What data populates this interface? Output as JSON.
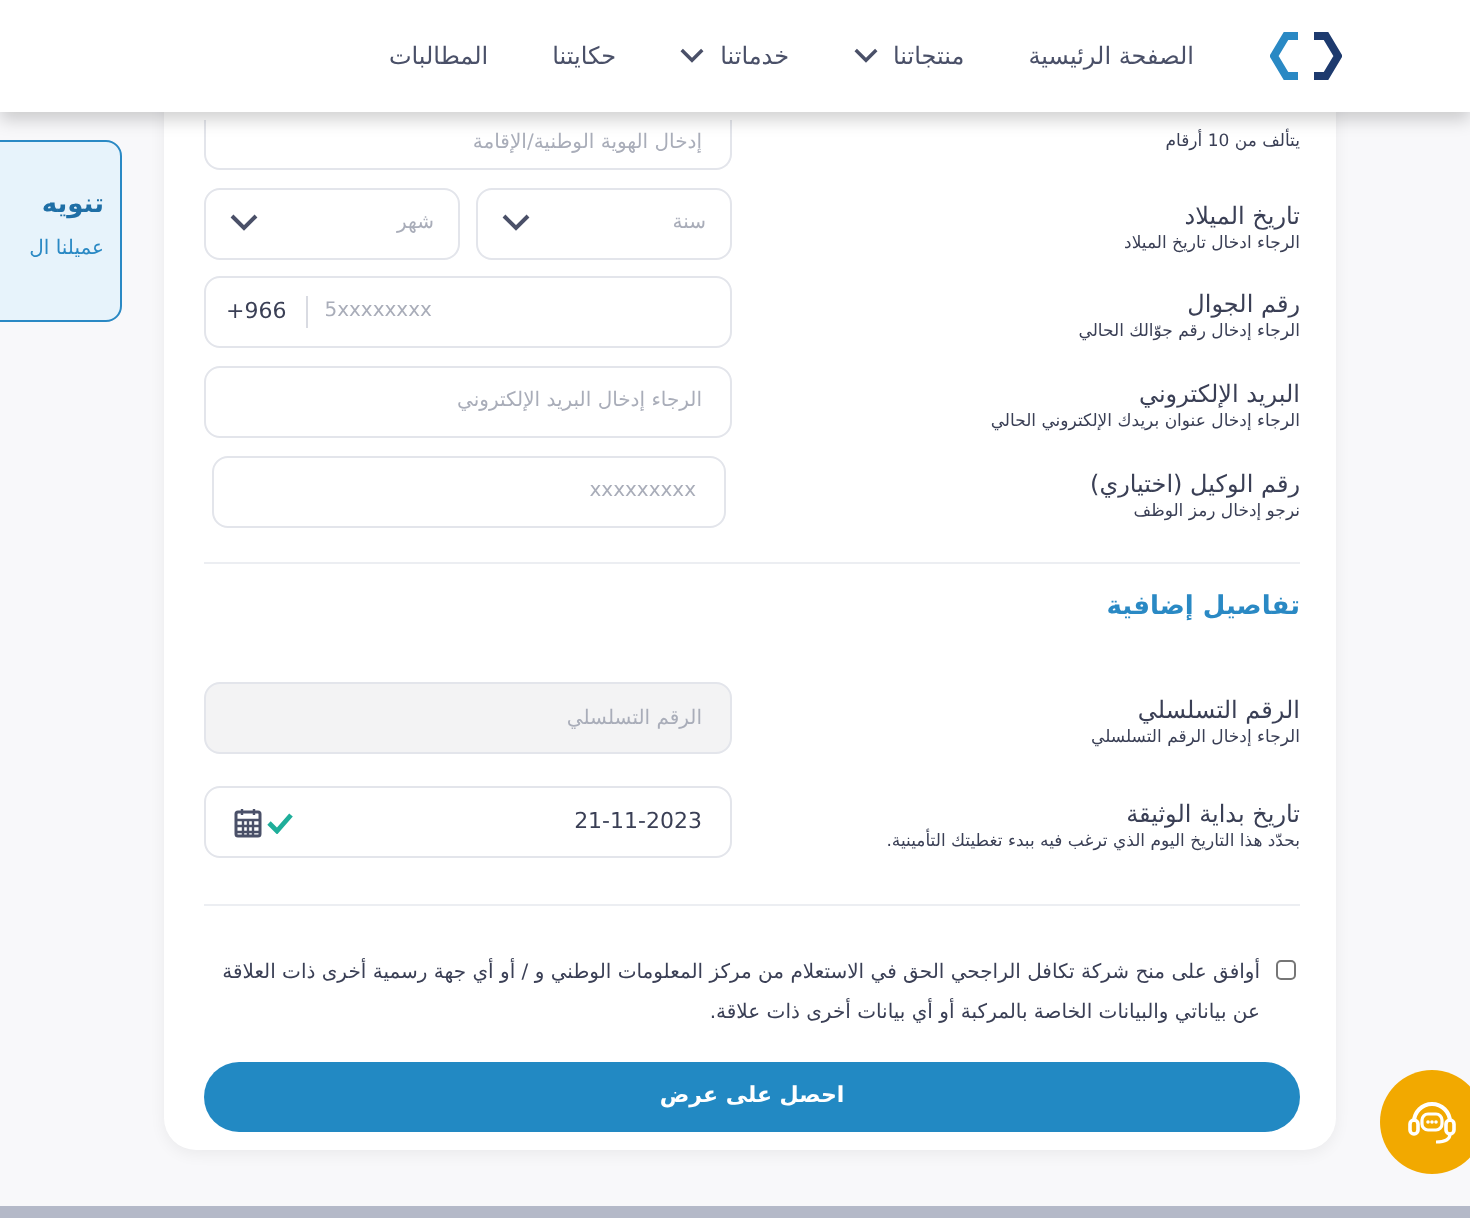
{
  "header": {
    "nav": [
      {
        "label": "الصفحة الرئيسية",
        "dropdown": false
      },
      {
        "label": "منتجاتنا",
        "dropdown": true
      },
      {
        "label": "خدماتنا",
        "dropdown": true
      },
      {
        "label": "حكايتنا",
        "dropdown": false
      },
      {
        "label": "المطالبات",
        "dropdown": false
      }
    ]
  },
  "notice": {
    "title": "تنويه",
    "text": "عميلنا ال"
  },
  "fields": [
    {
      "kind": "text",
      "hint": "يتألف من 10 أرقام",
      "placeholder": "إدخال الهوية الوطنية/الإقامة",
      "disabled": false
    },
    {
      "kind": "select_pair",
      "label": "تاريخ الميلاد",
      "hint": "الرجاء ادخال تاريخ الميلاد",
      "options": [
        "سنة",
        "شهر"
      ]
    },
    {
      "kind": "phone",
      "label": "رقم الجوال",
      "hint": "الرجاء إدخال رقم جوّالك الحالي",
      "prefix": "+966",
      "placeholder": "5xxxxxxxx"
    },
    {
      "kind": "text",
      "label": "البريد الإلكتروني",
      "hint": "الرجاء إدخال عنوان بريدك الإلكتروني الحالي",
      "placeholder": "الرجاء إدخال البريد الإلكتروني",
      "disabled": false
    },
    {
      "kind": "text",
      "label": "رقم الوكيل (اختياري)",
      "hint": "نرجو إدخال رمز الوظف",
      "placeholder": "xxxxxxxxx",
      "disabled": false
    },
    {
      "kind": "heading",
      "label": "تفاصيل إضافية"
    },
    {
      "kind": "text",
      "label": "الرقم التسلسلي",
      "hint": "الرجاء إدخال الرقم التسلسلي",
      "placeholder": "الرقم التسلسلي",
      "disabled": true
    },
    {
      "kind": "date",
      "label": "تاريخ بداية الوثيقة",
      "hint": "بحدّد هذا التاريخ اليوم الذي ترغب فيه ببدء تغطيتك التأمينية.",
      "value": "21-11-2023",
      "valid": true
    }
  ],
  "consent": {
    "text": "أوافق على منح شركة تكافل الراجحي الحق في الاستعلام من مركز المعلومات الوطني و / أو أي جهة رسمية أخرى ذات العلاقة عن بياناتي والبيانات الخاصة بالمركبة أو أي بيانات أخرى ذات علاقة.",
    "checked": false
  },
  "submit": "احصل على عرض"
}
